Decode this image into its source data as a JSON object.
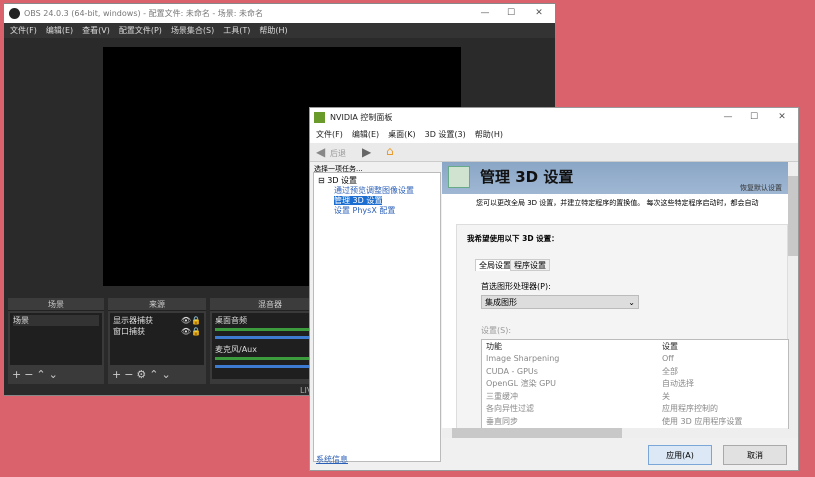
{
  "obs": {
    "title": "OBS 24.0.3 (64-bit, windows) - 配置文件: 未命名 - 场景: 未命名",
    "menu": [
      "文件(F)",
      "编辑(E)",
      "查看(V)",
      "配置文件(P)",
      "场景集合(S)",
      "工具(T)",
      "帮助(H)"
    ],
    "scenes": {
      "title": "场景",
      "items": [
        "场景"
      ]
    },
    "sources": {
      "title": "来源",
      "items": [
        "显示器捕获",
        "窗口捕获"
      ]
    },
    "mixer": {
      "title": "混音器",
      "tracks": [
        "桌面音频",
        "麦克风/Aux"
      ]
    },
    "status": "LIV"
  },
  "nvidia": {
    "title": "NVIDIA 控制面板",
    "menu": [
      "文件(F)",
      "编辑(E)",
      "桌面(K)",
      "3D 设置(3)",
      "帮助(H)"
    ],
    "back": "后退",
    "task_label": "选择一项任务...",
    "tree": {
      "root": "3D 设置",
      "children": [
        "通过预览调整图像设置",
        "管理 3D 设置",
        "设置 PhysX 配置"
      ]
    },
    "heading": "管理 3D 设置",
    "restore": "恢复默认设置",
    "description": "您可以更改全局 3D 设置，并建立特定程序的置换值。 每次这些特定程序启动时，都会自动",
    "section": "我希望使用以下 3D 设置：",
    "tabs": [
      "全局设置",
      "程序设置"
    ],
    "gpu_label": "首选图形处理器(P):",
    "gpu_value": "集成图形",
    "settings_label": "设置(S):",
    "columns": [
      "功能",
      "设置"
    ],
    "rows": [
      [
        "Image Sharpening",
        "Off"
      ],
      [
        "CUDA - GPUs",
        "全部"
      ],
      [
        "OpenGL 渲染 GPU",
        "自动选择"
      ],
      [
        "三重缓冲",
        "关"
      ],
      [
        "各向异性过滤",
        "应用程序控制的"
      ],
      [
        "垂直同步",
        "使用 3D 应用程序设置"
      ]
    ],
    "sysinfo": "系统信息",
    "apply": "应用(A)",
    "cancel": "取消"
  }
}
